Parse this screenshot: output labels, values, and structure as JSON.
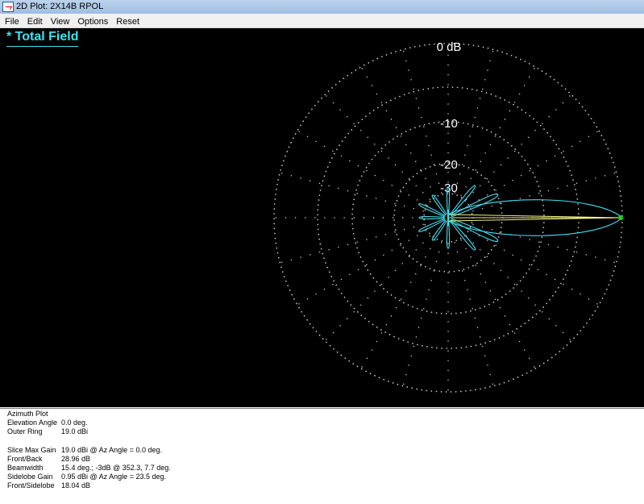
{
  "window": {
    "title": "2D Plot: 2X14B RPOL"
  },
  "menu": [
    "File",
    "Edit",
    "View",
    "Options",
    "Reset"
  ],
  "plot": {
    "title": "* Total Field",
    "ring_labels": [
      "0 dB",
      "-10",
      "-20",
      "-30"
    ],
    "colors": {
      "background": "#000000",
      "grid": "#cfcfcf",
      "pattern": "#40e0f0",
      "max_line": "#f0f080",
      "marker": "#20d020"
    }
  },
  "info": {
    "plot_type": "Azimuth Plot",
    "rows": [
      {
        "label": "Elevation Angle",
        "value": "0.0 deg."
      },
      {
        "label": "Outer Ring",
        "value": "19.0 dBi"
      },
      {
        "label": "Slice Max Gain",
        "value": "19.0 dBi @ Az Angle = 0.0 deg."
      },
      {
        "label": "Front/Back",
        "value": "28.96 dB"
      },
      {
        "label": "Beamwidth",
        "value": "15.4 deg.; -3dB @ 352.3, 7.7 deg."
      },
      {
        "label": "Sidelobe Gain",
        "value": "0.95 dBi @ Az Angle = 23.5 deg."
      },
      {
        "label": "Front/Sidelobe",
        "value": "18.04 dB"
      }
    ]
  }
}
